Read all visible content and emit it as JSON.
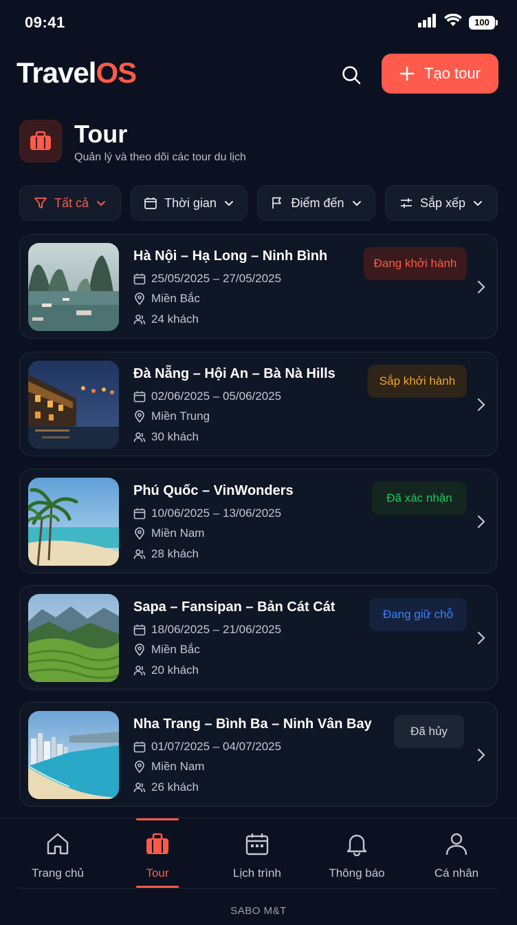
{
  "status_bar": {
    "time": "09:41",
    "battery": "100"
  },
  "header": {
    "logo_main": "Travel",
    "logo_accent": "OS",
    "create_label": "Tạo tour"
  },
  "page": {
    "title": "Tour",
    "subtitle": "Quản lý và theo dõi các tour du lịch"
  },
  "filters": [
    {
      "label": "Tất cả",
      "icon": "filter-icon",
      "active": true
    },
    {
      "label": "Thời gian",
      "icon": "calendar-icon",
      "active": false
    },
    {
      "label": "Điểm đến",
      "icon": "flag-icon",
      "active": false
    },
    {
      "label": "Sắp xếp",
      "icon": "sliders-icon",
      "active": false
    }
  ],
  "tours": [
    {
      "title": "Hà Nội – Hạ Long – Ninh Bình",
      "dates": "25/05/2025 – 27/05/2025",
      "region": "Miền Bắc",
      "guests": "24 khách",
      "status": "Đang khởi hành",
      "status_color": "#ff5a4a",
      "status_bg": "#3a1a1c",
      "image": "ha-long-bay-photo"
    },
    {
      "title": "Đà Nẵng – Hội An – Bà Nà Hills",
      "dates": "02/06/2025 – 05/06/2025",
      "region": "Miền Trung",
      "guests": "30 khách",
      "status": "Sắp khởi hành",
      "status_color": "#f5a524",
      "status_bg": "#2e2418",
      "image": "hoi-an-lanterns-photo"
    },
    {
      "title": "Phú Quốc – VinWonders",
      "dates": "10/06/2025 – 13/06/2025",
      "region": "Miền Nam",
      "guests": "28 khách",
      "status": "Đã xác nhận",
      "status_color": "#22c55e",
      "status_bg": "#13261f",
      "image": "phu-quoc-beach-photo"
    },
    {
      "title": "Sapa – Fansipan – Bản Cát Cát",
      "dates": "18/06/2025 – 21/06/2025",
      "region": "Miền Bắc",
      "guests": "20 khách",
      "status": "Đang giữ chỗ",
      "status_color": "#3b82f6",
      "status_bg": "#15223d",
      "image": "sapa-terraces-photo"
    },
    {
      "title": "Nha Trang – Bình Ba – Ninh Vân Bay",
      "dates": "01/07/2025 – 04/07/2025",
      "region": "Miền Nam",
      "guests": "26 khách",
      "status": "Đã hủy",
      "status_color": "#d6dae1",
      "status_bg": "#1d2433",
      "image": "nha-trang-coast-photo"
    }
  ],
  "bottom_nav": [
    {
      "label": "Trang chủ",
      "icon": "home-icon",
      "active": false
    },
    {
      "label": "Tour",
      "icon": "briefcase-icon",
      "active": true
    },
    {
      "label": "Lịch trình",
      "icon": "calendar-icon",
      "active": false
    },
    {
      "label": "Thông báo",
      "icon": "bell-icon",
      "active": false
    },
    {
      "label": "Cá nhân",
      "icon": "user-icon",
      "active": false
    }
  ],
  "footer": {
    "text": "SABO M&T"
  },
  "colors": {
    "background": "#0b1120",
    "accent": "#ff5b4c",
    "card": "#0f1625"
  }
}
